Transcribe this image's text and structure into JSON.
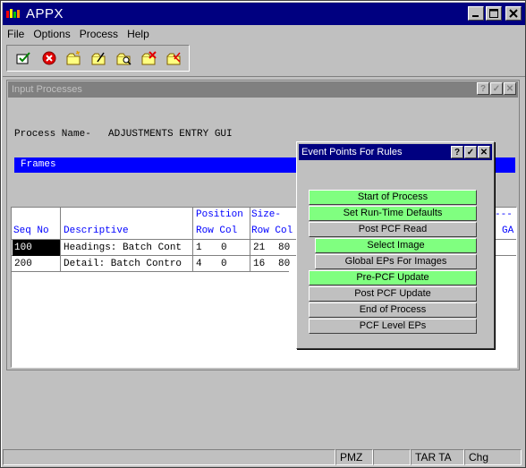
{
  "app": {
    "title": "APPX"
  },
  "window_buttons": {
    "minimize": "_",
    "maximize": "□",
    "close": "✕"
  },
  "menu": {
    "items": [
      {
        "label": "File"
      },
      {
        "label": "Options"
      },
      {
        "label": "Process"
      },
      {
        "label": "Help"
      }
    ]
  },
  "toolbar": {
    "buttons": [
      {
        "name": "end-icon"
      },
      {
        "name": "cancel-icon"
      },
      {
        "name": "add-icon"
      },
      {
        "name": "change-icon"
      },
      {
        "name": "inquire-icon"
      },
      {
        "name": "delete-icon"
      },
      {
        "name": "review-icon"
      }
    ]
  },
  "child_window": {
    "title": "Input Processes",
    "buttons": {
      "help": "?",
      "ok": "✓",
      "close": "✕"
    },
    "process_name_label": "Process Name-",
    "process_name_value": "ADJUSTMENTS ENTRY GUI",
    "frames_label": "Frames"
  },
  "grid": {
    "headers": {
      "seq_no": "Seq No",
      "descriptive": "Descriptive",
      "position": "Position",
      "row_col_1": "Row Col",
      "size": "Size-",
      "row_col_2": "Row Col",
      "dashes": "---",
      "ga": "GA"
    },
    "rows": [
      {
        "seq": "100",
        "descriptive": "Headings: Batch Cont",
        "pos_row": "1",
        "pos_col": "0",
        "size_row": "21",
        "size_col": "80"
      },
      {
        "seq": "200",
        "descriptive": "Detail: Batch Contro",
        "pos_row": "4",
        "pos_col": "0",
        "size_row": "16",
        "size_col": "80"
      }
    ]
  },
  "dialog": {
    "title": "Event Points For Rules",
    "buttons": {
      "help": "?",
      "ok": "✓",
      "close": "✕"
    },
    "event_points": [
      {
        "label": "Start of Process",
        "color": "#80ff80"
      },
      {
        "label": "Set Run-Time Defaults",
        "color": "#80ff80"
      },
      {
        "label": "Post PCF Read",
        "color": "#c0c0c0"
      },
      {
        "label": "Select Image",
        "color": "#80ff80"
      },
      {
        "label": "Global EPs For Images",
        "color": "#c0c0c0"
      },
      {
        "label": "Pre-PCF Update",
        "color": "#80ff80"
      },
      {
        "label": "Post PCF Update",
        "color": "#c0c0c0"
      },
      {
        "label": "End of Process",
        "color": "#c0c0c0"
      },
      {
        "label": "PCF Level EPs",
        "color": "#c0c0c0"
      }
    ]
  },
  "statusbar": {
    "panels": [
      "",
      "PMZ",
      "",
      "TAR TA",
      "Chg"
    ]
  }
}
